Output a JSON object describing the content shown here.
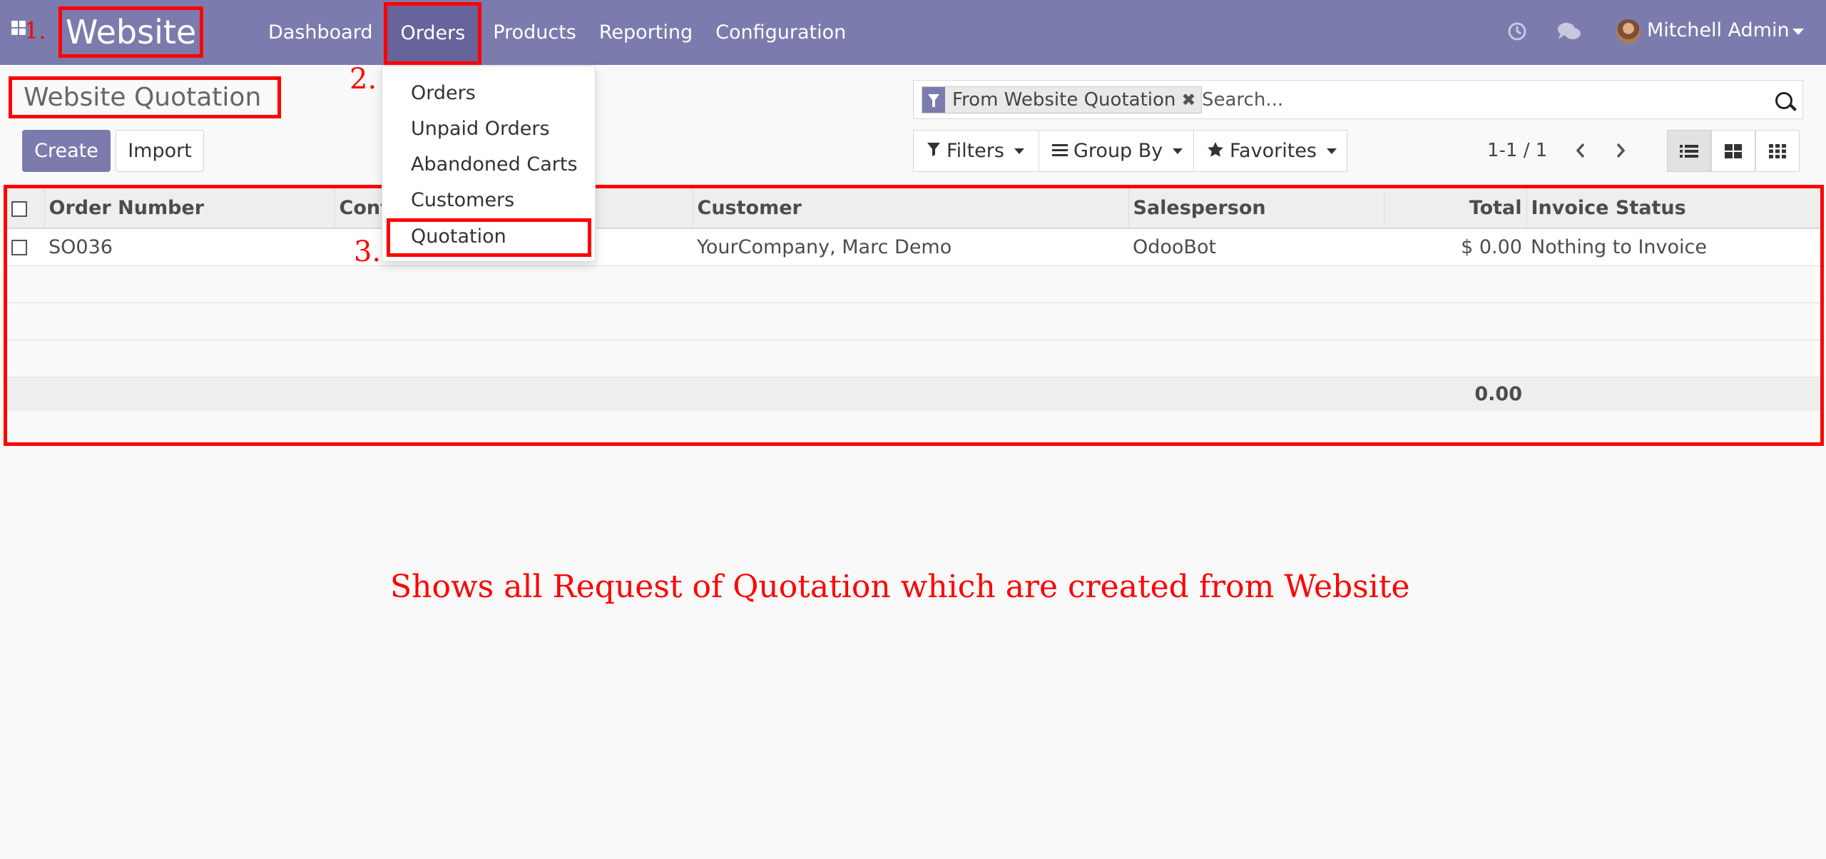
{
  "navbar": {
    "app_name": "Website",
    "menu": [
      "Dashboard",
      "Orders",
      "Products",
      "Reporting",
      "Configuration"
    ],
    "user_name": "Mitchell Admin"
  },
  "annotations": {
    "step1": "1.",
    "step2": "2.",
    "step3": "3.",
    "caption": "Shows all Request of Quotation which are created from Website",
    "highlight_color": "#ff0000"
  },
  "orders_dropdown": {
    "items": [
      "Orders",
      "Unpaid Orders",
      "Abandoned Carts",
      "Customers",
      "Quotation"
    ]
  },
  "control_panel": {
    "title": "Website Quotation",
    "create_label": "Create",
    "import_label": "Import",
    "search_facet": "From Website Quotation",
    "search_placeholder": "Search...",
    "filters_label": "Filters",
    "group_by_label": "Group By",
    "favorites_label": "Favorites",
    "pager": "1-1 / 1"
  },
  "list": {
    "columns": [
      "Order Number",
      "Conf",
      "Customer",
      "Salesperson",
      "Total",
      "Invoice Status"
    ],
    "rows": [
      {
        "order_number": "SO036",
        "confirmation_date": "",
        "customer": "YourCompany, Marc Demo",
        "salesperson": "OdooBot",
        "total": "$ 0.00",
        "invoice_status": "Nothing to Invoice"
      }
    ],
    "footer_total": "0.00"
  },
  "colors": {
    "brand": "#7c7bad",
    "navbar_active": "#66649a",
    "background": "#f9f9f9"
  }
}
